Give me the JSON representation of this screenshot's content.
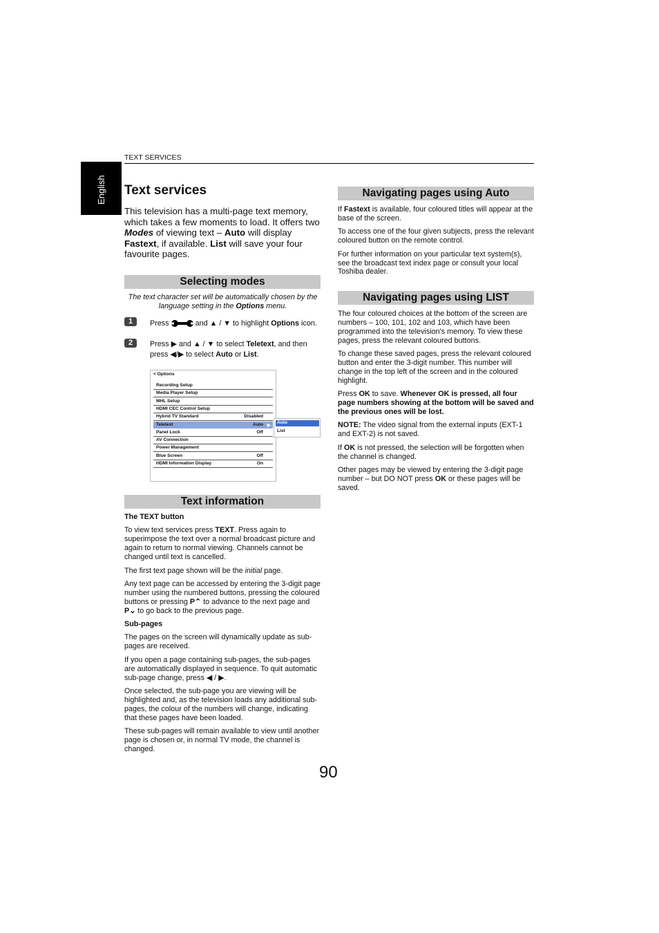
{
  "header": "TEXT SERVICES",
  "side_tab": "English",
  "title": "Text services",
  "intro": [
    {
      "t": "This television has a multi-page text memory, which takes a few moments to load. It offers two "
    },
    {
      "t": "Modes",
      "s": "bi"
    },
    {
      "t": " of viewing text – "
    },
    {
      "t": "Auto",
      "s": "b"
    },
    {
      "t": " will display "
    },
    {
      "t": "Fastext",
      "s": "b"
    },
    {
      "t": ", if available. "
    },
    {
      "t": "List",
      "s": "b"
    },
    {
      "t": " will save your four favourite pages."
    }
  ],
  "selecting": {
    "heading": "Selecting modes",
    "note": [
      {
        "t": "The text character set will be automatically chosen by the language setting in the "
      },
      {
        "t": "Options",
        "s": "b"
      },
      {
        "t": " menu."
      }
    ],
    "step1": {
      "num": "1",
      "press": "Press",
      "and": "and",
      "slash": "/",
      "rest": "to highlight ",
      "options": "Options",
      "icon_word": " icon."
    },
    "step2": {
      "num": "2",
      "press": "Press",
      "and": "and",
      "slash": "/",
      "rest": "to select ",
      "teletext": "Teletext",
      "then": ", and then press",
      "slash2": "/",
      "rest2": "to select ",
      "auto": "Auto",
      "or": " or ",
      "list": "List",
      "end": "."
    },
    "menu": {
      "back": "< Options",
      "rows": [
        {
          "label": "Recording Setup",
          "value": ""
        },
        {
          "label": "Media Player Setup",
          "value": ""
        },
        {
          "label": "MHL Setup",
          "value": ""
        },
        {
          "label": "HDMI CEC Control Setup",
          "value": ""
        },
        {
          "label": "Hybrid TV Standard",
          "value": "Disabled"
        },
        {
          "label": "Teletext",
          "value": "Auto",
          "selected": true
        },
        {
          "label": "Panel Lock",
          "value": "Off"
        },
        {
          "label": "AV Connection",
          "value": ""
        },
        {
          "label": "Power Management",
          "value": ""
        },
        {
          "label": "Blue Screen",
          "value": "Off"
        },
        {
          "label": "HDMI Information Display",
          "value": "On"
        }
      ],
      "submenu": [
        "Auto",
        "List"
      ],
      "highlight_color": "#8aa5dc",
      "submenu_highlight": "#3d6cc8"
    }
  },
  "text_info": {
    "heading": "Text information",
    "paras": [
      [
        {
          "t": "The TEXT button",
          "s": "b"
        }
      ],
      [
        {
          "t": "To view text services press "
        },
        {
          "t": "TEXT",
          "s": "b"
        },
        {
          "t": ". Press again to superimpose the text over a normal broadcast picture and again to return to normal viewing. Channels cannot be changed until text is cancelled."
        }
      ],
      [
        {
          "t": "The first text page shown will be the "
        },
        {
          "t": "initial",
          "s": "i"
        },
        {
          "t": " page."
        }
      ],
      [
        {
          "t": "Any text page can be accessed by entering the 3-digit page number using the numbered buttons, pressing the coloured buttons or pressing "
        },
        {
          "t": "P⌃",
          "s": "b"
        },
        {
          "t": " to advance to the next page and "
        },
        {
          "t": "P⌄",
          "s": "b"
        },
        {
          "t": " to go back to the previous page."
        }
      ],
      [
        {
          "t": "Sub-pages",
          "s": "b"
        }
      ],
      [
        {
          "t": "The pages on the screen will dynamically update as sub-pages are received."
        }
      ],
      [
        {
          "t": "If you open a page containing sub-pages, the sub-pages are automatically displayed in sequence. To quit automatic sub-page change, press ◀ / ▶."
        }
      ],
      [
        {
          "t": "Once selected, the sub-page you are viewing will be highlighted and, as the television loads any additional sub-pages, the colour of the numbers will change, indicating that these pages have been loaded."
        }
      ],
      [
        {
          "t": "These sub-pages will remain available to view until another page is chosen or, in normal TV mode, the channel is changed."
        }
      ]
    ]
  },
  "nav_auto": {
    "heading": "Navigating pages using Auto",
    "paras": [
      [
        {
          "t": "If "
        },
        {
          "t": "Fastext",
          "s": "b"
        },
        {
          "t": " is available, four coloured titles will appear at the base of the screen."
        }
      ],
      [
        {
          "t": "To access one of the four given subjects, press the relevant coloured button on the remote control."
        }
      ],
      [
        {
          "t": "For further information on your particular text system(s), see the broadcast text index page or consult your local Toshiba dealer."
        }
      ]
    ]
  },
  "nav_list": {
    "heading": "Navigating pages using LIST",
    "paras": [
      [
        {
          "t": "The four coloured choices at the bottom of the screen are numbers – 100, 101, 102 and 103, which have been programmed into the television's memory. To view these pages, press the relevant coloured buttons."
        }
      ],
      [
        {
          "t": "To change these saved pages, press the relevant coloured button and enter the 3-digit number. This number will change in the top left of the screen and in the coloured highlight."
        }
      ],
      [
        {
          "t": "Press "
        },
        {
          "t": "OK",
          "s": "b"
        },
        {
          "t": " to save. "
        },
        {
          "t": "Whenever OK is pressed, all four page numbers showing at the bottom will be saved and the previous ones will be lost.",
          "s": "b"
        }
      ],
      [
        {
          "t": "NOTE:",
          "s": "b"
        },
        {
          "t": " The video signal from the external inputs (EXT-1 and EXT-2) is not saved."
        }
      ],
      [
        {
          "t": "If "
        },
        {
          "t": "OK",
          "s": "b"
        },
        {
          "t": " is not pressed, the selection will be forgotten when the channel is changed."
        }
      ],
      [
        {
          "t": "Other pages may be viewed by entering the 3-digit page number – but DO NOT press "
        },
        {
          "t": "OK",
          "s": "b"
        },
        {
          "t": " or these pages will be saved."
        }
      ]
    ]
  },
  "page_number": "90"
}
